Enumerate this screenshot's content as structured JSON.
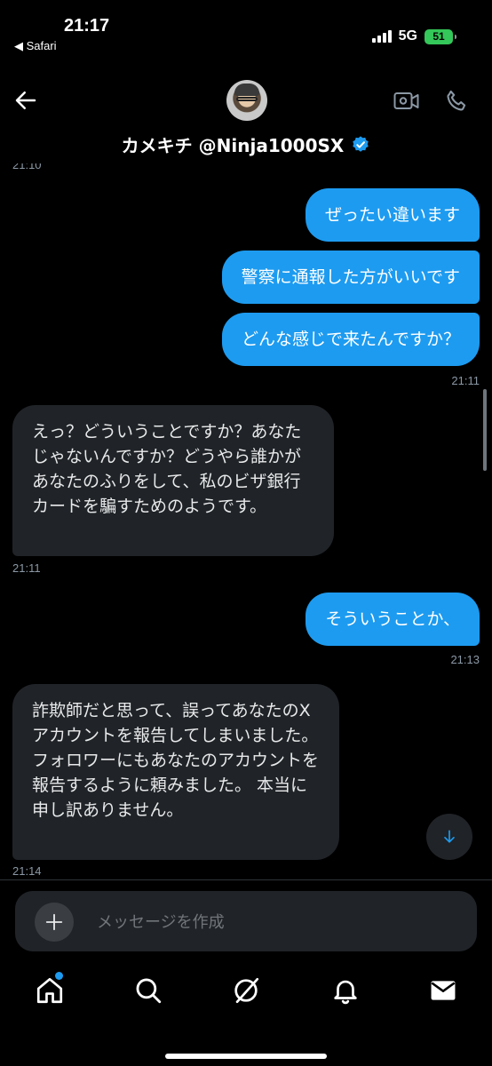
{
  "status_bar": {
    "time": "21:17",
    "back_app": "◀ Safari",
    "network": "5G",
    "battery": "51"
  },
  "header": {
    "title": "カメキチ @Ninja1000SX",
    "verified_icon": "verified-badge-icon",
    "accent": "#1d9bf0"
  },
  "messages": {
    "top_time_partial": "21:10",
    "out1": "ぜったい違います",
    "out2": "警察に通報した方がいいです",
    "out3": "どんな感じで来たんですか？",
    "out_time1": "21:11",
    "in1": "えっ？どういうことですか？あなたじゃないんですか？どうやら誰かがあなたのふりをして、私のビザ銀行カードを騙すためのようです。",
    "in_time1": "21:11",
    "out4": "そういうことか、",
    "out_time2": "21:13",
    "in2": "詐欺師だと思って、誤ってあなたのXアカウントを報告してしまいました。 フォロワーにもあなたのアカウントを報告するように頼みました。 本当に申し訳ありません。",
    "in_time2": "21:14"
  },
  "composer": {
    "placeholder": "メッセージを作成"
  },
  "nav": {
    "items": [
      "home-icon",
      "search-icon",
      "grok-icon",
      "notifications-icon",
      "messages-icon"
    ]
  }
}
